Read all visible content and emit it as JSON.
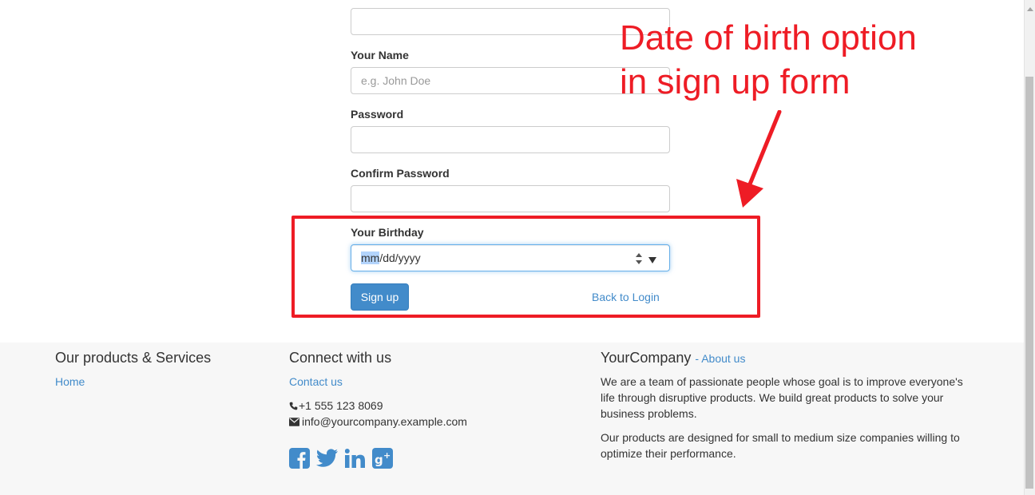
{
  "form": {
    "name_label": "Your Name",
    "name_placeholder": "e.g. John Doe",
    "password_label": "Password",
    "confirm_label": "Confirm Password",
    "birthday_label": "Your Birthday",
    "birthday_mm": "mm",
    "birthday_rest": "/dd/yyyy",
    "signup_button": "Sign up",
    "back_link": "Back to Login"
  },
  "annotation": {
    "line1": "Date of birth option",
    "line2": "in sign up form",
    "color": "#ee1c25"
  },
  "footer": {
    "products_title": "Our products & Services",
    "home_link": "Home",
    "connect_title": "Connect with us",
    "contact_link": "Contact us",
    "phone": "+1 555 123 8069",
    "email": "info@yourcompany.example.com",
    "company_name": "YourCompany",
    "about_link": "- About us",
    "about_p1": "We are a team of passionate people whose goal is to improve everyone's life through disruptive products. We build great products to solve your business problems.",
    "about_p2": "Our products are designed for small to medium size companies willing to optimize their performance.",
    "social_icons": [
      "facebook-icon",
      "twitter-icon",
      "linkedin-icon",
      "google-plus-icon"
    ]
  },
  "colors": {
    "primary": "#428bca",
    "annotation_red": "#ee1c25",
    "footer_bg": "#f7f7f7"
  }
}
